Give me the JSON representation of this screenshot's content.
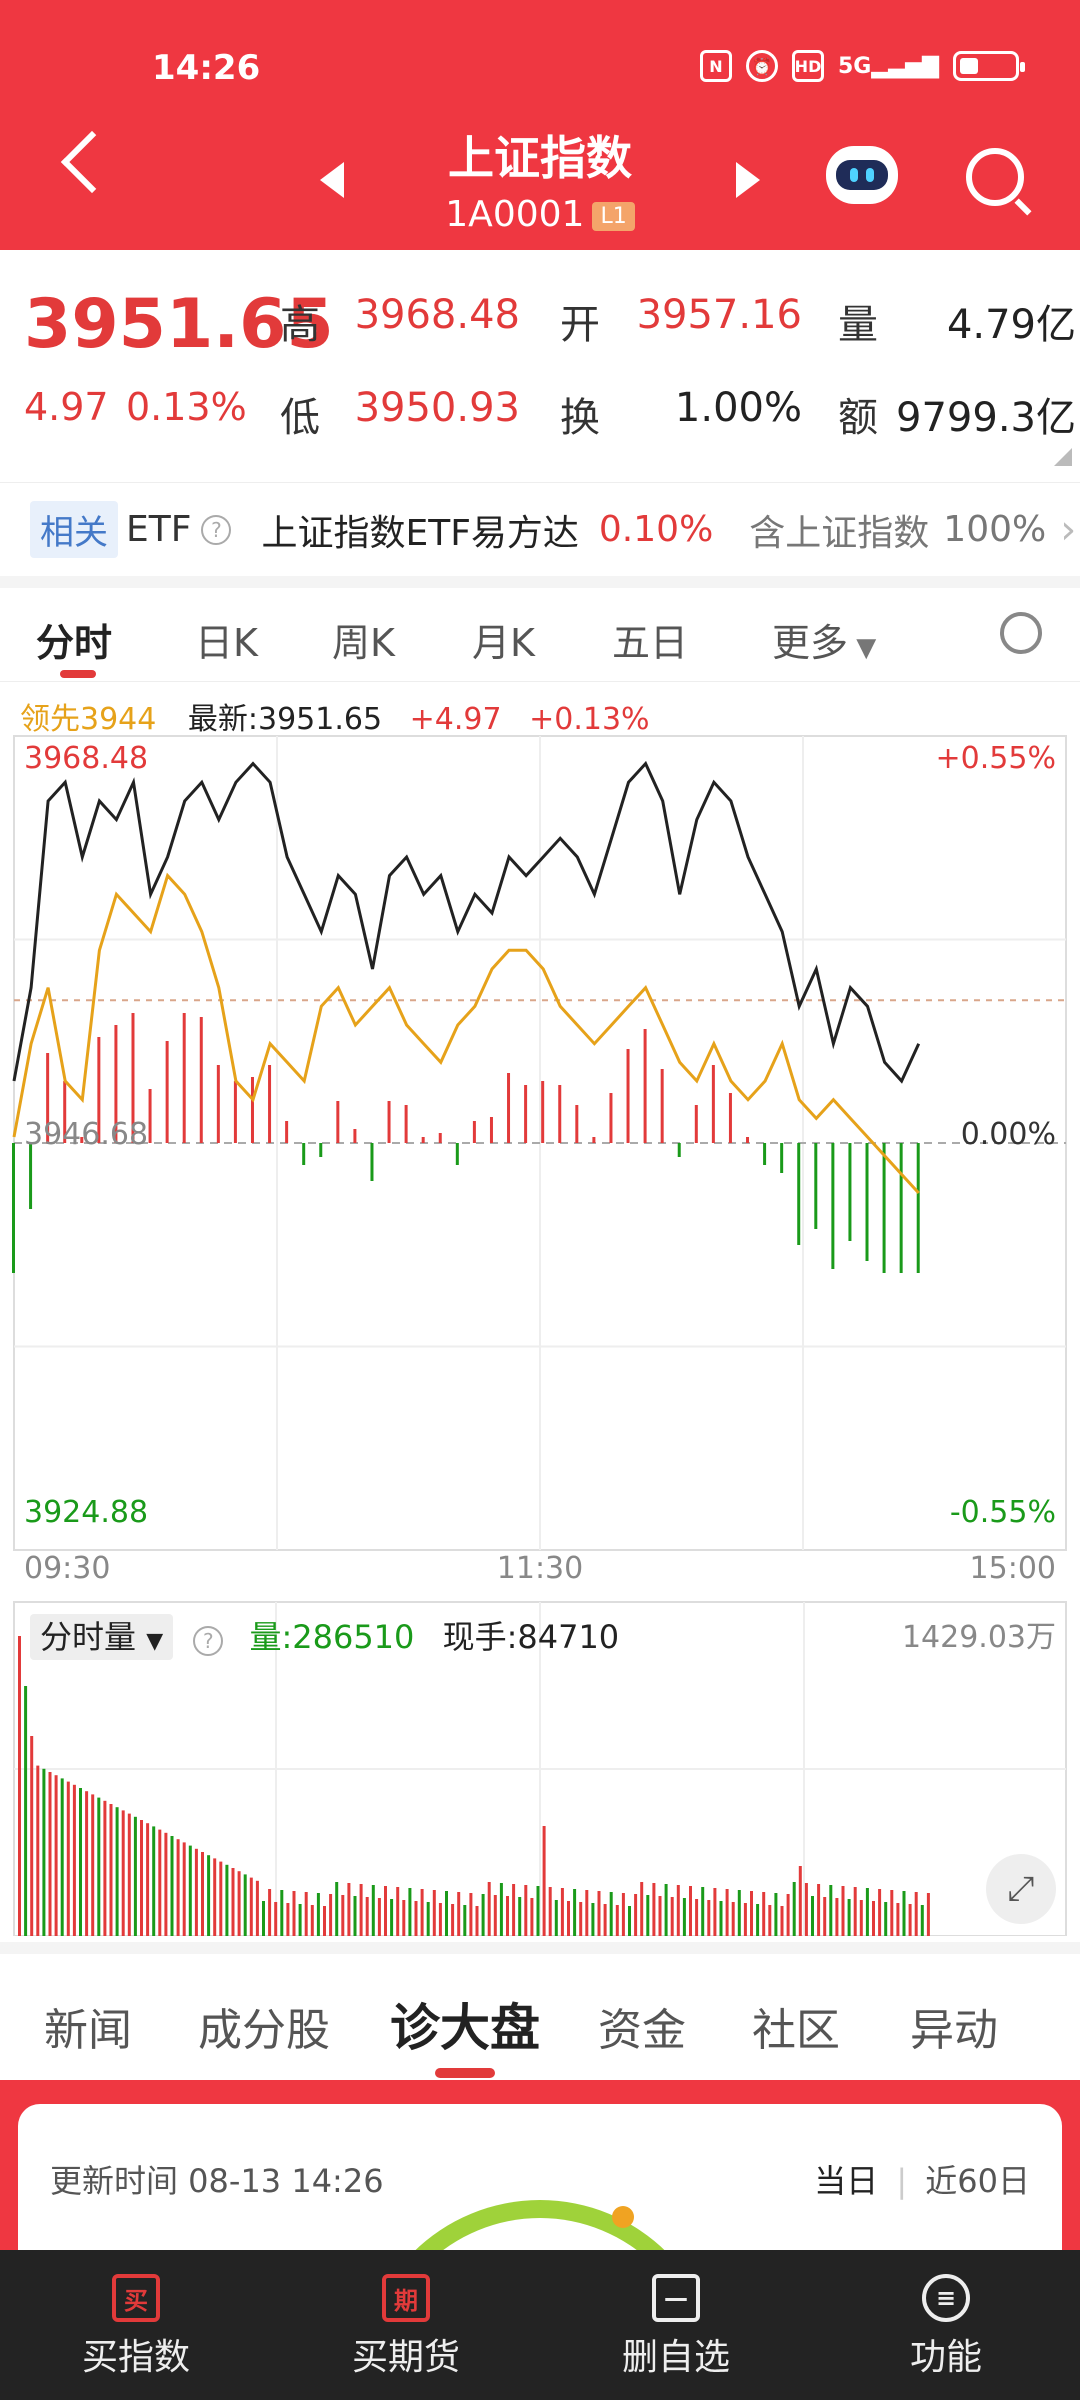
{
  "status": {
    "time": "14:26",
    "icons": [
      "nfc-icon",
      "alarm-icon",
      "hd-icon",
      "5g-signal-icon",
      "battery-icon"
    ]
  },
  "header": {
    "title": "上证指数",
    "code": "1A0001",
    "level_badge": "L1"
  },
  "quote": {
    "price": "3951.65",
    "change": "4.97",
    "change_pct": "0.13%",
    "high_label": "高",
    "high": "3968.48",
    "open_label": "开",
    "open": "3957.16",
    "volume_label": "量",
    "volume": "4.79亿",
    "low_label": "低",
    "low": "3950.93",
    "turnover_label": "换",
    "turnover": "1.00%",
    "amount_label": "额",
    "amount": "9799.3亿"
  },
  "etf": {
    "tag": "相关",
    "name": "ETF",
    "fund": "上证指数ETF易方达",
    "fund_change": "0.10%",
    "holding_label": "含上证指数",
    "holding_pct": "100%"
  },
  "chart_tabs": [
    "分时",
    "日K",
    "周K",
    "月K",
    "五日",
    "更多"
  ],
  "chart_header": {
    "lead": "领先3944",
    "latest": "最新:3951.65",
    "change": "+4.97",
    "change_pct": "+0.13%"
  },
  "chart_data": {
    "type": "line",
    "x_ticks": [
      "09:30",
      "11:30",
      "15:00"
    ],
    "y_left_top": "3968.48",
    "y_left_mid": "3946.68",
    "y_left_bottom": "3924.88",
    "y_right_top": "+0.55%",
    "y_right_mid": "0.00%",
    "y_right_bottom": "-0.55%",
    "ylim": [
      3924.88,
      3968.48
    ],
    "series": [
      {
        "color": "#222222",
        "values": [
          3950,
          3955,
          3965,
          3966,
          3962,
          3965,
          3964,
          3966,
          3960,
          3962,
          3965,
          3966,
          3964,
          3966,
          3967,
          3966,
          3962,
          3960,
          3958,
          3961,
          3960,
          3956,
          3961,
          3962,
          3960,
          3961,
          3958,
          3960,
          3959,
          3962,
          3961,
          3962,
          3963,
          3962,
          3960,
          3963,
          3966,
          3967,
          3965,
          3960,
          3964,
          3966,
          3965,
          3962,
          3960,
          3958,
          3954,
          3956,
          3952,
          3955,
          3954,
          3951,
          3950,
          3952
        ]
      },
      {
        "color": "#e6a21a",
        "values": [
          3947,
          3952,
          3955,
          3950,
          3949,
          3957,
          3960,
          3959,
          3958,
          3961,
          3960,
          3958,
          3955,
          3950,
          3949,
          3952,
          3951,
          3950,
          3954,
          3955,
          3953,
          3954,
          3955,
          3953,
          3952,
          3951,
          3953,
          3954,
          3956,
          3957,
          3957,
          3956,
          3954,
          3953,
          3952,
          3953,
          3954,
          3955,
          3953,
          3951,
          3950,
          3952,
          3950,
          3949,
          3950,
          3952,
          3949,
          3948,
          3949,
          3948,
          3947,
          3946,
          3945,
          3944
        ]
      }
    ]
  },
  "volume": {
    "label": "分时量",
    "vol_label": "量:286510",
    "hand_label": "现手:84710",
    "max": "1429.03万"
  },
  "news_tabs": [
    "新闻",
    "成分股",
    "诊大盘",
    "资金",
    "社区",
    "异动"
  ],
  "analysis": {
    "update": "更新时间 08-13 14:26",
    "today": "当日",
    "period": "近60日"
  },
  "bottom_bar": [
    {
      "icon": "买",
      "label": "买指数"
    },
    {
      "icon": "期",
      "label": "买期货"
    },
    {
      "icon": "—",
      "label": "删自选"
    },
    {
      "icon": "≡",
      "label": "功能"
    }
  ]
}
